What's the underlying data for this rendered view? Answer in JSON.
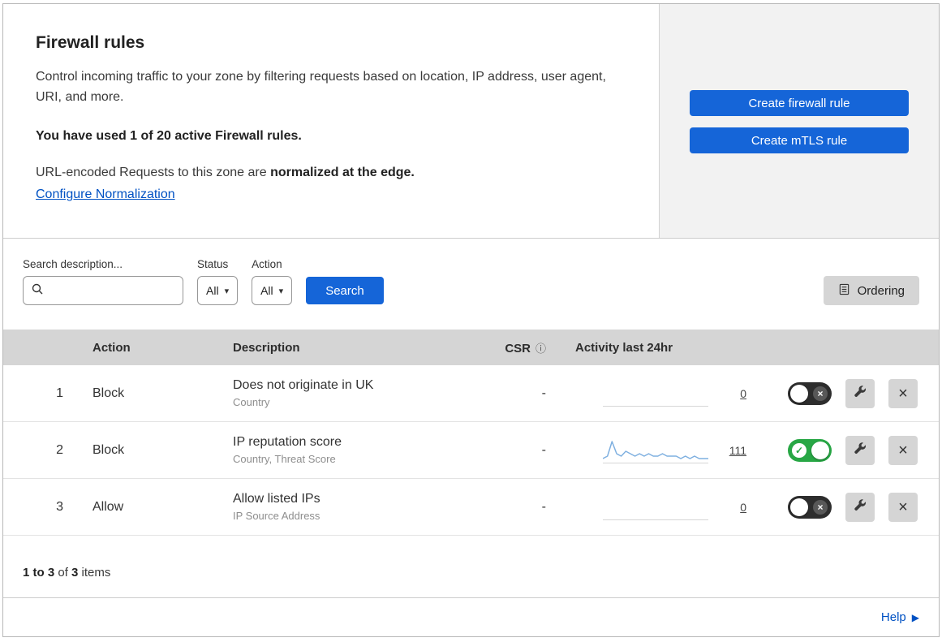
{
  "colors": {
    "primary_button": "#1565d8",
    "link_blue": "#0051c3",
    "toggle_on_green": "#28a745",
    "toggle_off_dark": "#2d2d2d",
    "table_header_gray": "#d5d5d5",
    "side_panel_gray": "#f2f2f2",
    "sparkline_blue": "#7fb0e0"
  },
  "overview": {
    "title": "Firewall rules",
    "description": "Control incoming traffic to your zone by filtering requests based on location, IP address, user agent, URI, and more.",
    "usage": "You have used 1 of 20 active Firewall rules.",
    "normalization_prefix": "URL-encoded Requests to this zone are ",
    "normalization_bold": "normalized at the edge.",
    "normalization_link": "Configure Normalization",
    "create_firewall_button": "Create firewall rule",
    "create_mtls_button": "Create mTLS rule"
  },
  "filters": {
    "search_label": "Search description...",
    "status_label": "Status",
    "status_value": "All",
    "action_label": "Action",
    "action_value": "All",
    "search_button": "Search",
    "ordering_button": "Ordering"
  },
  "table": {
    "headers": {
      "action": "Action",
      "description": "Description",
      "csr": "CSR",
      "activity": "Activity last 24hr"
    },
    "rows": [
      {
        "num": "1",
        "action": "Block",
        "description": "Does not originate in UK",
        "criteria": "Country",
        "csr": "-",
        "count": "0",
        "enabled": false,
        "sparkline": []
      },
      {
        "num": "2",
        "action": "Block",
        "description": "IP reputation score",
        "criteria": "Country, Threat Score",
        "csr": "-",
        "count": "111",
        "enabled": true,
        "sparkline": [
          1,
          2,
          8,
          3,
          2,
          4,
          3,
          2,
          3,
          2,
          3,
          2,
          2,
          3,
          2,
          2,
          2,
          1,
          2,
          1,
          2,
          1,
          1,
          1
        ]
      },
      {
        "num": "3",
        "action": "Allow",
        "description": "Allow listed IPs",
        "criteria": "IP Source Address",
        "csr": "-",
        "count": "0",
        "enabled": false,
        "sparkline": []
      }
    ]
  },
  "footer": {
    "range": "1 to 3",
    "of_text": " of ",
    "total": "3",
    "items_text": " items",
    "help_label": "Help"
  }
}
